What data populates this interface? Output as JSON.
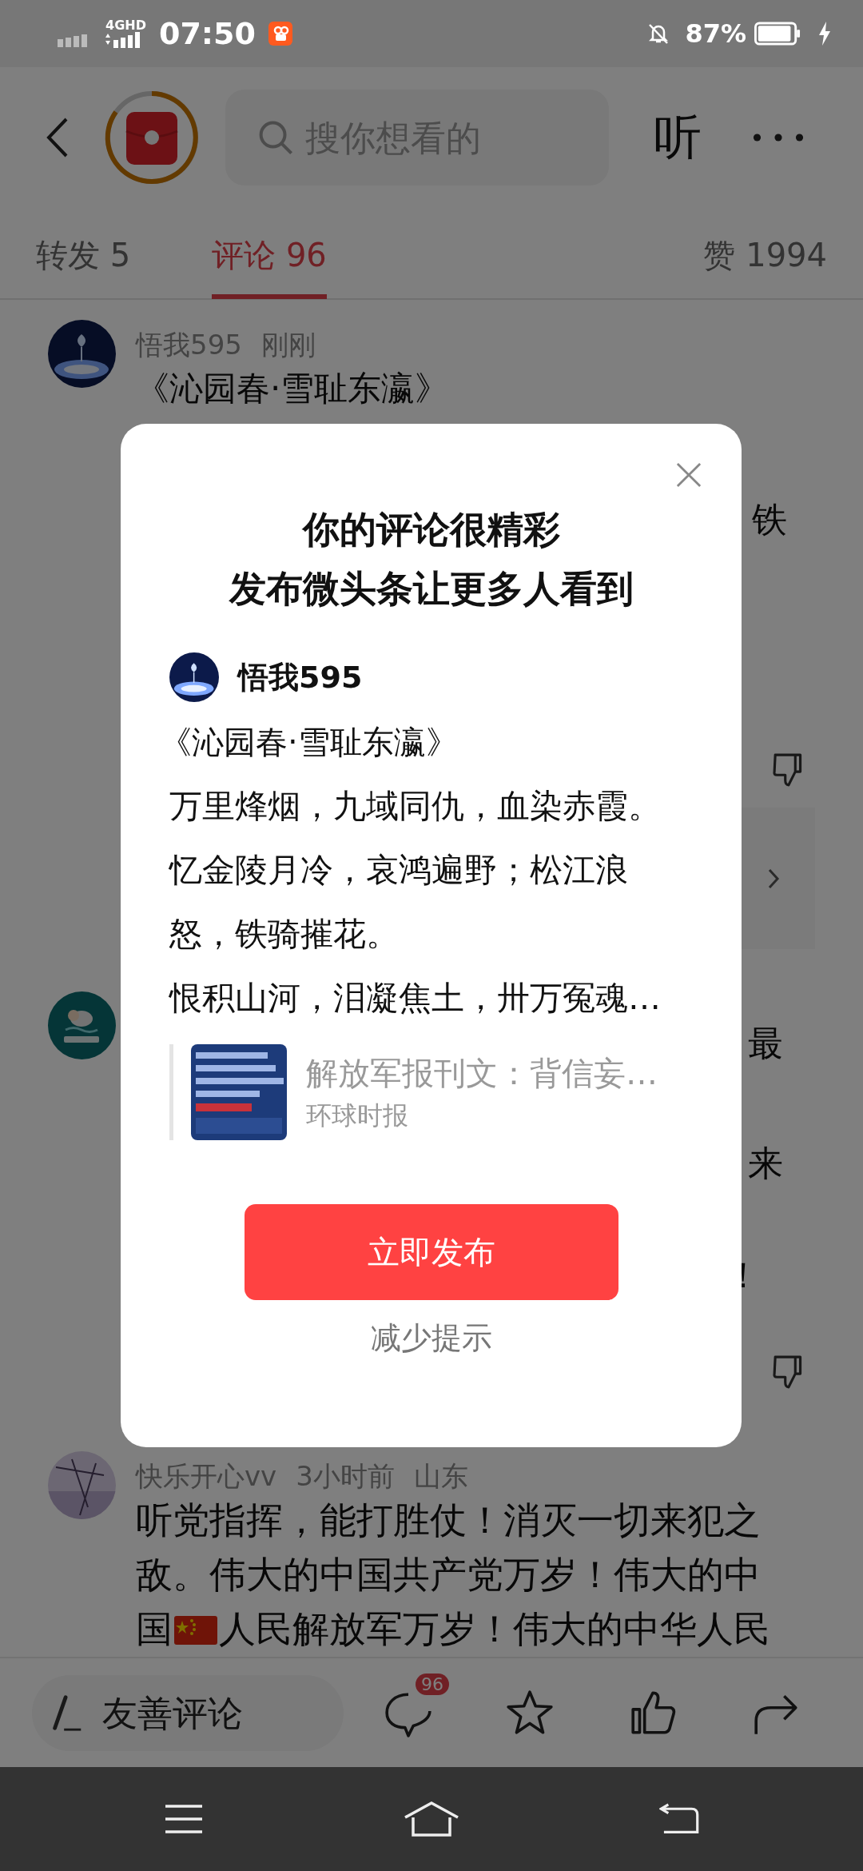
{
  "status_bar": {
    "network": "4GHD",
    "time": "07:50",
    "battery": "87%"
  },
  "header": {
    "search_placeholder": "搜你想看的",
    "listen": "听"
  },
  "tabs": [
    {
      "label": "转发 5",
      "selected": false
    },
    {
      "label": "评论 96",
      "selected": true
    },
    {
      "label": "赞 1994",
      "selected": false
    }
  ],
  "comments": [
    {
      "author": "悟我595",
      "time": "刚刚",
      "title": "《沁园春·雪耻东瀛》",
      "visible_fragments": [
        "铁"
      ]
    },
    {
      "visible_fragments": [
        "最",
        "来",
        "！"
      ]
    },
    {
      "author": "快乐开心vv",
      "time": "3小时前",
      "location": "山东",
      "body": "听党指挥，能打胜仗！消灭一切来犯之敌。伟大的中国共产党万岁！伟大的中国",
      "body_after_flag": "人民解放军万岁！伟大的中华人民"
    }
  ],
  "dialog": {
    "title_lines": [
      "你的评论很精彩",
      "发布微头条让更多人看到"
    ],
    "author": "悟我595",
    "poem_title": "《沁园春·雪耻东瀛》",
    "poem_lines": [
      "万里烽烟，九域同仇，血染赤霞。",
      "忆金陵月冷，哀鸿遍野；松江浪怒，铁骑摧花。",
      "恨积山河，泪凝焦土，卅万冤魂…"
    ],
    "link": {
      "title": "解放军报刊文：背信妄…",
      "source": "环球时报"
    },
    "publish_button": "立即发布",
    "dismiss_link": "减少提示"
  },
  "bottom_bar": {
    "comment_placeholder": "友善评论",
    "comment_count": "96"
  }
}
